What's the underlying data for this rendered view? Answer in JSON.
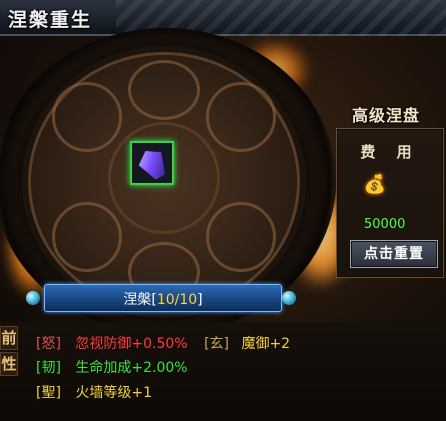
{
  "window": {
    "title": "涅槃重生"
  },
  "item": {
    "name": "purple-weapon-icon"
  },
  "side_panel": {
    "title": "高级涅盘",
    "cost_label": "费 用",
    "cost_icon": "gold-ingot-icon",
    "cost_value": "50000",
    "reset_button": "点击重置"
  },
  "level_bar": {
    "label": "涅槃",
    "level_open": "[",
    "level": "10/10",
    "level_close": "]"
  },
  "attributes": {
    "side_tags": [
      "前",
      "性"
    ],
    "rows": [
      {
        "tag": "[怒]",
        "text": "忽视防御+0.50%",
        "tag2": "[玄]",
        "text2": "魔御+2"
      },
      {
        "tag": "[韧]",
        "text": "生命加成+2.00%"
      },
      {
        "tag": "[聖]",
        "text": "火墙等级+1"
      }
    ]
  },
  "colors": {
    "accent_blue": "#2d6cb4",
    "green": "#39e33a",
    "red": "#ff3b3b",
    "gold": "#ffd23a"
  }
}
